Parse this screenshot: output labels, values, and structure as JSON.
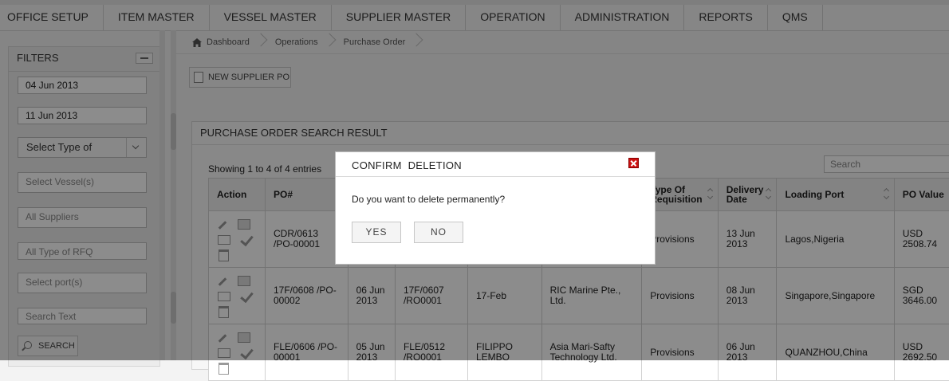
{
  "nav": [
    "OFFICE SETUP",
    "ITEM MASTER",
    "VESSEL MASTER",
    "SUPPLIER MASTER",
    "OPERATION",
    "ADMINISTRATION",
    "REPORTS",
    "QMS"
  ],
  "filters": {
    "title": "FILTERS",
    "date_from": "04 Jun 2013",
    "date_to": "11 Jun 2013",
    "type_select": "Select Type of",
    "vessel_placeholder": "Select Vessel(s)",
    "suppliers_placeholder": "All Suppliers",
    "rfq_placeholder": "All Type of RFQ",
    "port_placeholder": "Select port(s)",
    "search_text_placeholder": "Search Text",
    "search_button": "SEARCH"
  },
  "breadcrumb": [
    "Dashboard",
    "Operations",
    "Purchase Order"
  ],
  "new_po_button": "NEW SUPPLIER PO",
  "panel": {
    "title": "PURCHASE ORDER SEARCH RESULT",
    "showing": "Showing 1 to 4 of 4 entries",
    "search_placeholder": "Search"
  },
  "table": {
    "headers": [
      "Action",
      "PO#",
      "",
      "",
      "",
      "",
      "Type Of Requisition",
      "Delivery Date",
      "Loading Port",
      "PO Value"
    ],
    "rows": [
      [
        "",
        "CDR/0613 /PO-00001",
        "",
        "",
        "",
        "",
        "Provisions",
        "13 Jun 2013",
        "Lagos,Nigeria",
        "USD 2508.74"
      ],
      [
        "",
        "17F/0608 /PO-00002",
        "06 Jun 2013",
        "17F/0607 /RO0001",
        "17-Feb",
        "RIC Marine Pte., Ltd.",
        "Provisions",
        "08 Jun 2013",
        "Singapore,Singapore",
        "SGD 3646.00"
      ],
      [
        "",
        "FLE/0606 /PO-00001",
        "05 Jun 2013",
        "FLE/0512 /RO0001",
        "FILIPPO LEMBO",
        "Asia Mari-Safty Technology Ltd.",
        "Provisions",
        "06 Jun 2013",
        "QUANZHOU,China",
        "USD 2692.50"
      ]
    ]
  },
  "modal": {
    "title": "CONFIRM  DELETION",
    "message": "Do you want to delete permanently?",
    "yes": "YES",
    "no": "NO"
  }
}
